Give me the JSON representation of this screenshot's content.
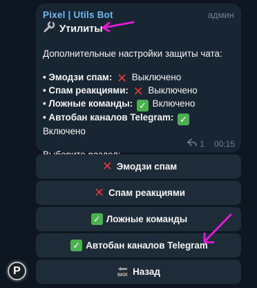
{
  "message": {
    "sender": "Pixel | Utils Bot",
    "role": "админ",
    "title": "Утилиты",
    "intro": "Дополнительные настройки защиты чата:",
    "statuses": [
      {
        "label": "• Эмодзи спам:",
        "icon": "cross-mark-icon",
        "state": "Выключено"
      },
      {
        "label": "• Спам реакциями:",
        "icon": "cross-mark-icon",
        "state": "Выключено"
      },
      {
        "label": "• Ложные команды:",
        "icon": "check-mark-icon",
        "state": "Включено"
      },
      {
        "label": "• Автобан каналов Telegram:",
        "icon": "check-mark-icon",
        "state": "Включено"
      }
    ],
    "prompt": "Выберите раздел:",
    "reply_count": "1",
    "time": "00:15"
  },
  "keyboard": {
    "buttons": [
      {
        "label": "Эмодзи спам",
        "icon": "cross-mark-icon"
      },
      {
        "label": "Спам реакциями",
        "icon": "cross-mark-icon"
      },
      {
        "label": "Ложные команды",
        "icon": "check-mark-icon"
      },
      {
        "label": "Автобан каналов Telegram",
        "icon": "check-mark-icon"
      },
      {
        "label": "Назад",
        "icon": "back-arrow-icon"
      }
    ]
  },
  "avatar": {
    "letter": "P"
  },
  "colors": {
    "background": "#0e1621",
    "bubble": "#182533",
    "button": "#1e2c3a",
    "sender": "#71baf2",
    "annotation_arrow": "#e81ad8"
  }
}
